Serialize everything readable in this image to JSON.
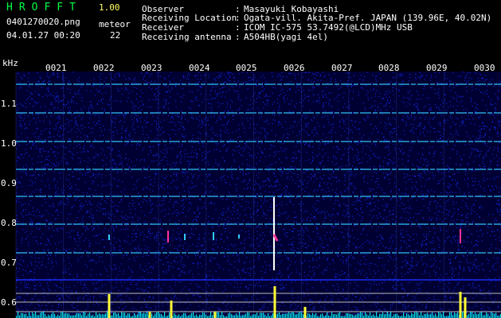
{
  "header": {
    "app_name": "HROFFT",
    "version": "1.00",
    "file_name": "0401270020.png",
    "timestamp": "04.01.27 00:20",
    "meteor_label": "meteor",
    "meteor_count": "22"
  },
  "station_info": [
    {
      "label": "Observer",
      "value": "Masayuki Kobayashi"
    },
    {
      "label": "Receiving Location",
      "value": "Ogata-vill. Akita-Pref. JAPAN (139.96E, 40.02N)"
    },
    {
      "label": "Receiver",
      "value": "ICOM IC-575 53.7492(@LCD)MHz USB"
    },
    {
      "label": "Receiving antenna",
      "value": "A504HB(yagi 4el)"
    }
  ],
  "spectrogram": {
    "y_unit": "kHz",
    "time_labels": [
      "0021",
      "0022",
      "0023",
      "0024",
      "0025",
      "0026",
      "0027",
      "0028",
      "0029",
      "0030"
    ],
    "freq_labels": [
      "1.1",
      "1.0",
      "0.9",
      "0.8",
      "0.7",
      "0.6"
    ],
    "colors": {
      "background": "#000033",
      "noise_blue": "#1a2fff",
      "carrier": "#33ccff",
      "meteor_hot": "#ff3399",
      "count_bar": "#ffff33",
      "baseline": "#00ffff"
    }
  }
}
